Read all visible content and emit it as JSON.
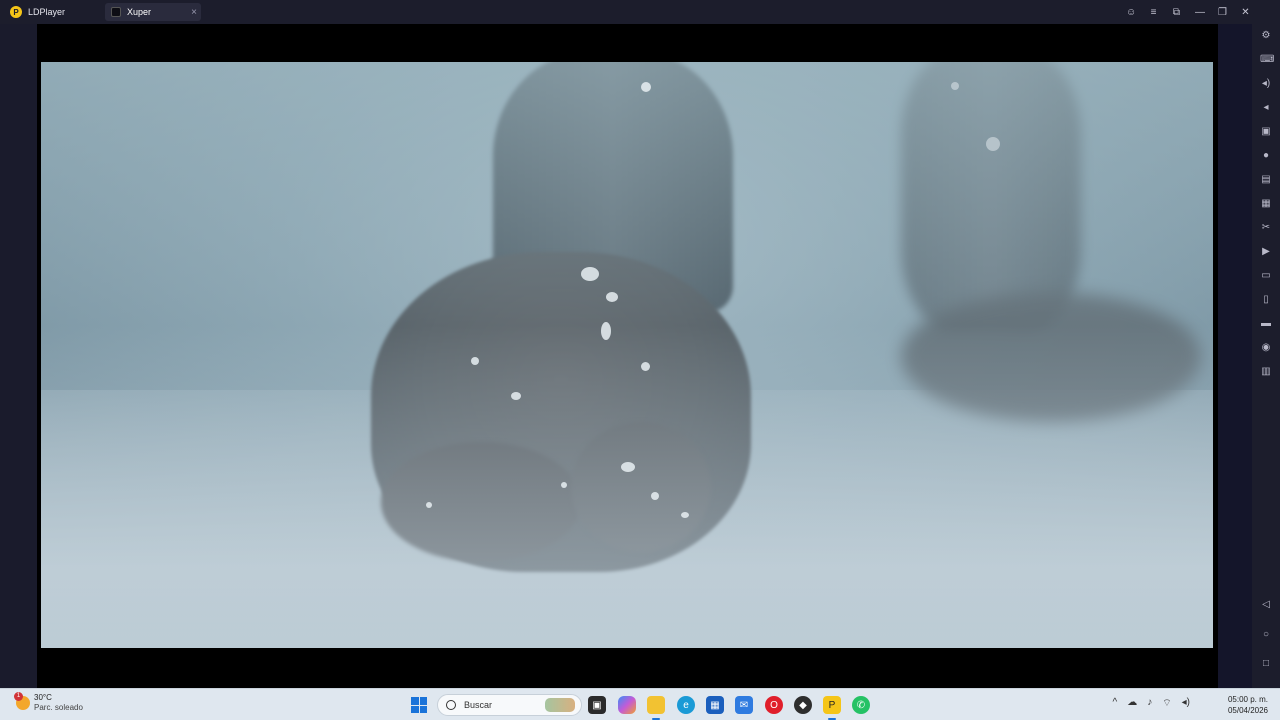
{
  "window": {
    "app_name": "LDPlayer",
    "tab_label": "Xuper",
    "tab_close": "×",
    "controls": [
      "☺",
      "≡",
      "⧉",
      "—",
      "❐",
      "✕"
    ]
  },
  "sidebar": {
    "buttons": [
      "gear-icon",
      "keyboard-icon",
      "volume-up-icon",
      "volume-down-icon",
      "screenshot-icon",
      "record-icon",
      "sync-icon",
      "robot-icon",
      "scissors-icon",
      "video-icon",
      "apk-icon",
      "phone-icon",
      "folder-icon",
      "location-icon",
      "multi-instance-icon"
    ],
    "nav": [
      "back-icon",
      "home-icon",
      "recents-icon"
    ]
  },
  "taskbar": {
    "weather_temp": "30°C",
    "weather_desc": "Parc. soleado",
    "weather_badge": "1",
    "search_placeholder": "Buscar",
    "clock_time": "05:00 p. m.",
    "clock_date": "05/04/2026",
    "colors": {
      "accent": "#1a73d9"
    }
  }
}
